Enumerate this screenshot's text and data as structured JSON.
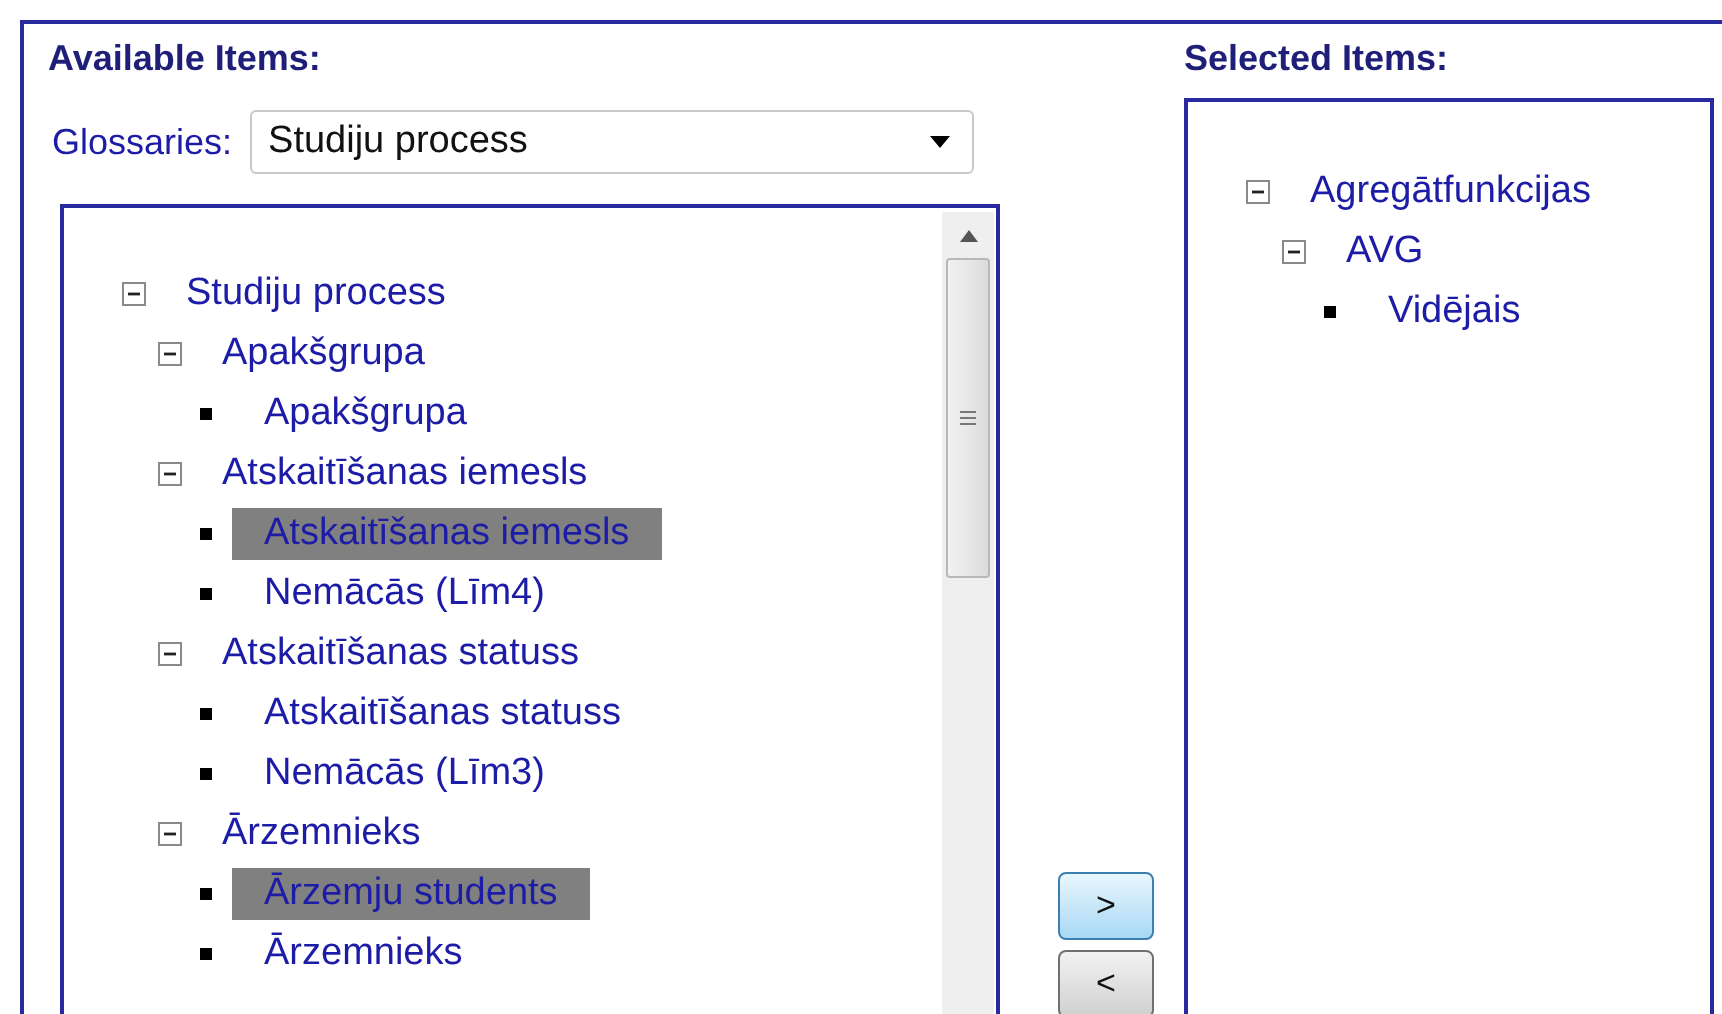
{
  "available": {
    "title": "Available Items:",
    "glossary": {
      "label": "Glossaries:",
      "value": "Studiju process"
    },
    "tree": [
      {
        "label": "Studiju process",
        "expanded": true,
        "selected": false,
        "children": [
          {
            "label": "Apakšgrupa",
            "expanded": true,
            "selected": false,
            "children": [
              {
                "label": "Apakšgrupa",
                "selected": false
              }
            ]
          },
          {
            "label": "Atskaitīšanas iemesls",
            "expanded": true,
            "selected": false,
            "children": [
              {
                "label": "Atskaitīšanas iemesls",
                "selected": true
              },
              {
                "label": "Nemācās (Līm4)",
                "selected": false
              }
            ]
          },
          {
            "label": "Atskaitīšanas statuss",
            "expanded": true,
            "selected": false,
            "children": [
              {
                "label": "Atskaitīšanas statuss",
                "selected": false
              },
              {
                "label": "Nemācās (Līm3)",
                "selected": false
              }
            ]
          },
          {
            "label": "Ārzemnieks",
            "expanded": true,
            "selected": false,
            "children": [
              {
                "label": "Ārzemju students",
                "selected": true
              },
              {
                "label": "Ārzemnieks",
                "selected": false
              }
            ]
          }
        ]
      }
    ]
  },
  "buttons": [
    {
      "label": ">",
      "focused": true
    },
    {
      "label": "<",
      "focused": false
    }
  ],
  "selected_items": {
    "title": "Selected Items:",
    "tree": [
      {
        "label": "Agregātfunkcijas",
        "expanded": true,
        "selected": false,
        "children": [
          {
            "label": "AVG",
            "expanded": true,
            "selected": false,
            "children": [
              {
                "label": "Vidējais",
                "selected": false
              }
            ]
          }
        ]
      }
    ]
  }
}
